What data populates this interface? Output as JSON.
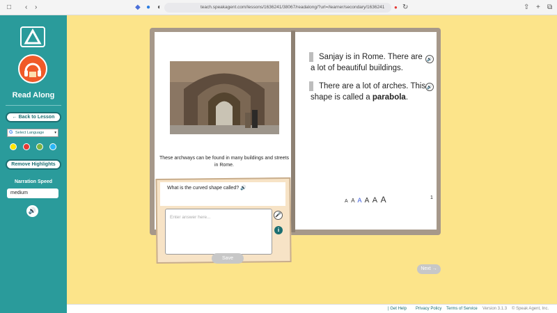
{
  "browser": {
    "url": "teach.speakagent.com/lessons/1636241/38067/readalong/?url=/learner/secondary/1636241",
    "icons": [
      "sidebar-toggle-icon",
      "back-arrow-icon",
      "forward-arrow-icon",
      "share-icon",
      "new-tab-icon",
      "tabs-icon"
    ]
  },
  "sidebar": {
    "title": "Read Along",
    "back_label": "← Back to Lesson",
    "language_label": "Select Language",
    "language_options": [
      "Select Language"
    ],
    "highlight_colors": [
      "#ffe600",
      "#e53935",
      "#7cb342",
      "#29b6f6"
    ],
    "remove_highlights_label": "Remove Highlights",
    "speed_label": "Narration Speed",
    "speed_value": "medium"
  },
  "book": {
    "caption": "These archways can be found in many buildings and streets in Rome.",
    "paragraph1": "Sanjay is in Rome. There are a lot of beautiful buildings.",
    "paragraph2_prefix": "There are a lot of arches. This shape is called a ",
    "paragraph2_bold": "parabola",
    "paragraph2_suffix": ".",
    "font_size_options": [
      "A",
      "A",
      "A",
      "A",
      "A",
      "A"
    ],
    "page_number": "1"
  },
  "question": {
    "text": "What is the curved shape called?",
    "answer_placeholder": "Enter answer here...",
    "save_label": "Save"
  },
  "next_label": "Next →",
  "footer": {
    "help": "| Get Help",
    "privacy": "Privacy Policy",
    "terms": "Terms of Service",
    "version": "Version 3.1.3",
    "copyright": "© Speak Agent, Inc."
  },
  "colors": {
    "accent": "#2a9b9b",
    "background": "#fce48a"
  }
}
